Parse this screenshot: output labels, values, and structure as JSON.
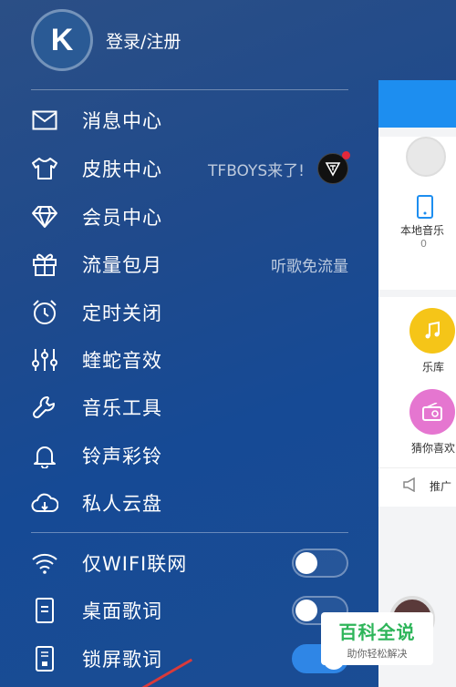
{
  "profile": {
    "avatar_letter": "K",
    "login_label": "登录/注册"
  },
  "menu": [
    {
      "label": "消息中心",
      "icon": "mail-icon",
      "hint": ""
    },
    {
      "label": "皮肤中心",
      "icon": "shirt-icon",
      "hint": "TFBOYS来了!"
    },
    {
      "label": "会员中心",
      "icon": "diamond-icon",
      "hint": ""
    },
    {
      "label": "流量包月",
      "icon": "gift-icon",
      "hint": "听歌免流量"
    },
    {
      "label": "定时关闭",
      "icon": "alarm-clock-icon",
      "hint": ""
    },
    {
      "label": "蝰蛇音效",
      "icon": "equalizer-icon",
      "hint": ""
    },
    {
      "label": "音乐工具",
      "icon": "wrench-icon",
      "hint": ""
    },
    {
      "label": "铃声彩铃",
      "icon": "bell-icon",
      "hint": ""
    },
    {
      "label": "私人云盘",
      "icon": "cloud-icon",
      "hint": ""
    }
  ],
  "toggles": [
    {
      "label": "仅WIFI联网",
      "icon": "wifi-icon",
      "on": false
    },
    {
      "label": "桌面歌词",
      "icon": "phone-lyrics-icon",
      "on": false
    },
    {
      "label": "锁屏歌词",
      "icon": "lockscreen-lyrics-icon",
      "on": true
    }
  ],
  "panel": {
    "local_music_label": "本地音乐",
    "local_music_count": "0",
    "library_label": "乐库",
    "guess_label": "猜你喜欢",
    "push_label": "推广"
  },
  "watermark": {
    "title": "百科全说",
    "subtitle": "助你轻松解决"
  },
  "colors": {
    "accent": "#2f86e6",
    "panel_header": "#1d8ef0",
    "library_btn": "#f5c518",
    "guess_btn": "#e576d0"
  }
}
